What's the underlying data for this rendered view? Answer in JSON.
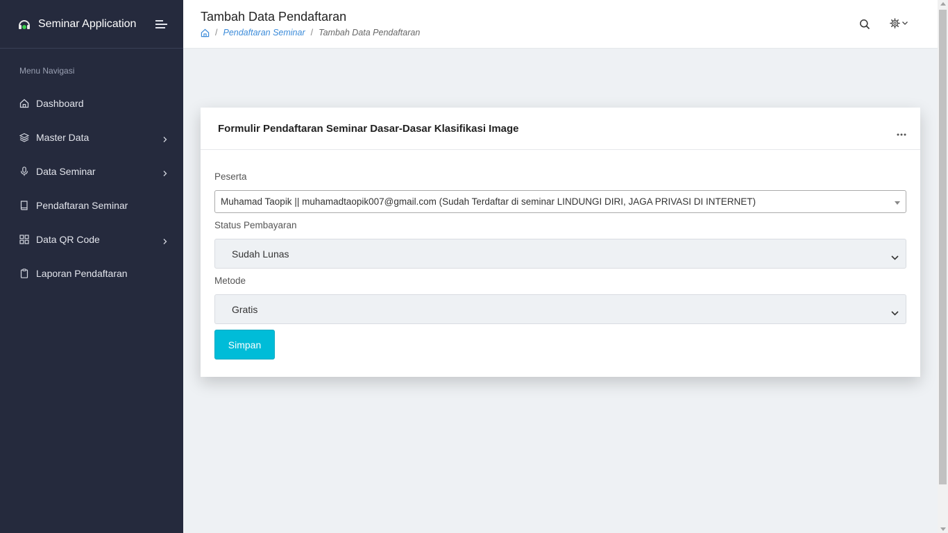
{
  "app": {
    "title": "Seminar Application",
    "accent": "#00bcd8",
    "sidebar_bg": "#252a3d"
  },
  "sidebar": {
    "caption": "Menu Navigasi",
    "items": [
      {
        "label": "Dashboard",
        "icon": "home-icon",
        "has_submenu": false
      },
      {
        "label": "Master Data",
        "icon": "layers-icon",
        "has_submenu": true
      },
      {
        "label": "Data Seminar",
        "icon": "microphone-icon",
        "has_submenu": true
      },
      {
        "label": "Pendaftaran Seminar",
        "icon": "book-icon",
        "has_submenu": false
      },
      {
        "label": "Data QR Code",
        "icon": "grid-icon",
        "has_submenu": true
      },
      {
        "label": "Laporan Pendaftaran",
        "icon": "clipboard-icon",
        "has_submenu": false
      }
    ]
  },
  "header": {
    "page_title": "Tambah Data Pendaftaran",
    "breadcrumb": {
      "home_icon": "home-icon",
      "link": "Pendaftaran Seminar",
      "current": "Tambah Data Pendaftaran"
    },
    "icons": [
      "search-icon",
      "gear-icon",
      "chevron-down-icon"
    ]
  },
  "form": {
    "card_title": "Formulir Pendaftaran Seminar Dasar-Dasar Klasifikasi Image",
    "peserta_label": "Peserta",
    "peserta_value": "Muhamad Taopik || muhamadtaopik007@gmail.com (Sudah Terdaftar di seminar LINDUNGI DIRI, JAGA PRIVASI DI INTERNET)",
    "status_label": "Status Pembayaran",
    "status_value": "Sudah Lunas",
    "metode_label": "Metode",
    "metode_value": "Gratis",
    "save_label": "Simpan"
  }
}
